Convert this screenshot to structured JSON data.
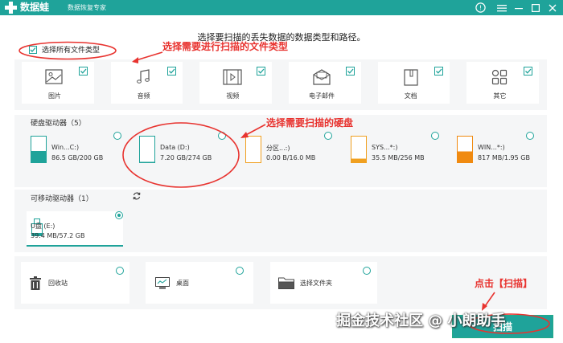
{
  "titlebar": {
    "brand": "数据蛙",
    "subtitle": "数据恢复专家"
  },
  "heading": "选择要扫描的丢失数据的数据类型和路径。",
  "select_all_label": "选择所有文件类型",
  "file_types": [
    {
      "label": "图片",
      "icon": "image-icon",
      "checked": true
    },
    {
      "label": "音频",
      "icon": "music-icon",
      "checked": true
    },
    {
      "label": "视频",
      "icon": "video-icon",
      "checked": true
    },
    {
      "label": "电子邮件",
      "icon": "email-icon",
      "checked": true
    },
    {
      "label": "文档",
      "icon": "document-icon",
      "checked": true
    },
    {
      "label": "其它",
      "icon": "apps-icon",
      "checked": true
    }
  ],
  "hdd_section": {
    "title": "硬盘驱动器（5）",
    "drives": [
      {
        "name": "Win...C:)",
        "size": "86.5 GB/200 GB",
        "used_fraction": 0.43,
        "color": "#1fa39a"
      },
      {
        "name": "Data (D:)",
        "size": "7.20 GB/274 GB",
        "used_fraction": 0.03,
        "color": "#1fa39a"
      },
      {
        "name": "分区...:)",
        "size": "0.00  B/16.0 MB",
        "used_fraction": 0.0,
        "color": "#f0a020"
      },
      {
        "name": "SYS...*:)",
        "size": "35.5 MB/256 MB",
        "used_fraction": 0.14,
        "color": "#f0a020"
      },
      {
        "name": "WIN...*:)",
        "size": "817 MB/1.95 GB",
        "used_fraction": 0.42,
        "color": "#f08a10"
      }
    ]
  },
  "removable_section": {
    "title": "可移动驱动器（1）",
    "drives": [
      {
        "name": "U盘 (E:)",
        "size": "39.4 MB/57.2 GB",
        "selected": true
      }
    ]
  },
  "locations": [
    {
      "label": "回收站",
      "icon": "recycle-bin-icon"
    },
    {
      "label": "桌面",
      "icon": "desktop-icon"
    },
    {
      "label": "选择文件夹",
      "icon": "folder-icon"
    }
  ],
  "annotations": {
    "types": "选择需要进行扫描的文件类型",
    "disk": "选择需要扫描的硬盘",
    "scan": "点击【扫描】"
  },
  "scan_button": "扫描",
  "watermark": "掘金技术社区 @ 小朗助手",
  "colors": {
    "accent": "#1fa39a",
    "annotation": "#e8332f"
  }
}
